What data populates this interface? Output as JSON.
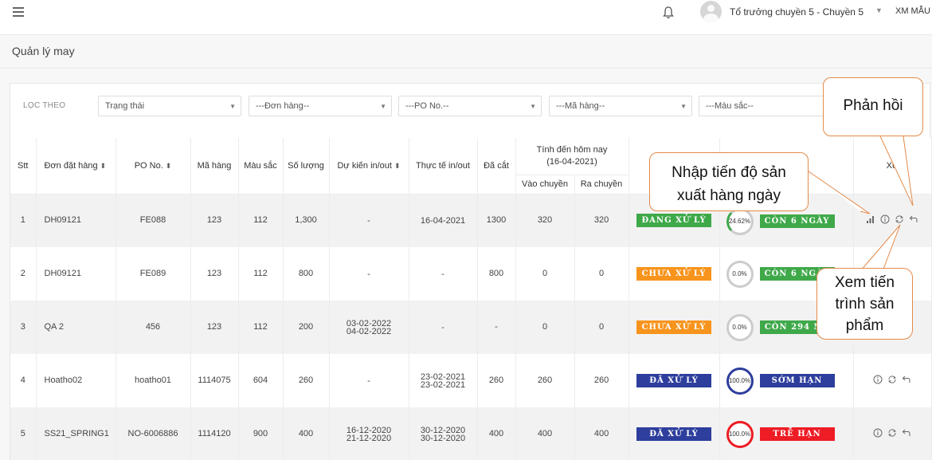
{
  "header": {
    "user_name": "Tổ trưởng chuyền 5 - Chuyền 5",
    "org": "XM MẪU"
  },
  "page": {
    "title": "Quản lý may"
  },
  "filters": {
    "label": "LỌC THEO",
    "status": "Trạng thái",
    "order": "---Đơn hàng--",
    "po": "---PO No.--",
    "item": "---Mã hàng--",
    "color": "---Màu sắc--"
  },
  "table": {
    "headers": {
      "stt": "Stt",
      "order": "Đơn đặt hàng",
      "po": "PO No.",
      "item": "Mã hàng",
      "color": "Màu sắc",
      "qty": "Số lượng",
      "planned": "Dự kiến in/out",
      "actual": "Thực tế in/out",
      "cut": "Đã cắt",
      "today_group_1": "Tính đến hôm nay",
      "today_group_2": "(16-04-2021)",
      "in_line": "Vào chuyền",
      "out_line": "Ra chuyền",
      "actions": "Xử"
    },
    "rows": [
      {
        "stt": "1",
        "order": "DH09121",
        "po": "FE088",
        "item": "123",
        "color": "112",
        "qty": "1,300",
        "planned_1": "-",
        "planned_2": "",
        "actual_1": "16-04-2021",
        "actual_2": "",
        "cut": "1300",
        "in": "320",
        "out": "320",
        "status": "ĐANG XỬ LÝ",
        "pct": "24.62%",
        "deadline": "CÒN 6 NGÀY"
      },
      {
        "stt": "2",
        "order": "DH09121",
        "po": "FE089",
        "item": "123",
        "color": "112",
        "qty": "800",
        "planned_1": "-",
        "planned_2": "",
        "actual_1": "-",
        "actual_2": "",
        "cut": "800",
        "in": "0",
        "out": "0",
        "status": "CHƯA XỬ LÝ",
        "pct": "0.0%",
        "deadline": "CÒN 6 NGÀY"
      },
      {
        "stt": "3",
        "order": "QA 2",
        "po": "456",
        "item": "123",
        "color": "112",
        "qty": "200",
        "planned_1": "03-02-2022",
        "planned_2": "04-02-2022",
        "actual_1": "-",
        "actual_2": "",
        "cut": "-",
        "in": "0",
        "out": "0",
        "status": "CHƯA XỬ LÝ",
        "pct": "0.0%",
        "deadline": "CÒN 294 NG"
      },
      {
        "stt": "4",
        "order": "Hoatho02",
        "po": "hoatho01",
        "item": "1114075",
        "color": "604",
        "qty": "260",
        "planned_1": "-",
        "planned_2": "",
        "actual_1": "23-02-2021",
        "actual_2": "23-02-2021",
        "cut": "260",
        "in": "260",
        "out": "260",
        "status": "ĐÃ XỬ LÝ",
        "pct": "100.0%",
        "deadline": "SỚM HẠN"
      },
      {
        "stt": "5",
        "order": "SS21_SPRING1",
        "po": "NO-6006886",
        "item": "1114120",
        "color": "900",
        "qty": "400",
        "planned_1": "16-12-2020",
        "planned_2": "21-12-2020",
        "actual_1": "30-12-2020",
        "actual_2": "30-12-2020",
        "cut": "400",
        "in": "400",
        "out": "400",
        "status": "ĐÃ XỬ LÝ",
        "pct": "100.0%",
        "deadline": "TRỄ HẠN"
      }
    ]
  },
  "callouts": {
    "feedback": "Phản hồi",
    "daily_line1": "Nhập tiến độ sản",
    "daily_line2": "xuất hàng ngày",
    "progress_line1": "Xem tiến",
    "progress_line2": "trình sản",
    "progress_line3": "phẩm"
  },
  "colors": {
    "green": "#3fa94a",
    "orange": "#f7941d",
    "navy": "#2d3e9c",
    "red": "#ee1c24",
    "callout_border": "#e48a4a"
  },
  "icons": [
    "menu-icon",
    "bell-icon",
    "avatar",
    "chevron-down-icon",
    "sort-icon",
    "bar-chart-icon",
    "info-icon",
    "refresh-icon",
    "reply-icon"
  ]
}
